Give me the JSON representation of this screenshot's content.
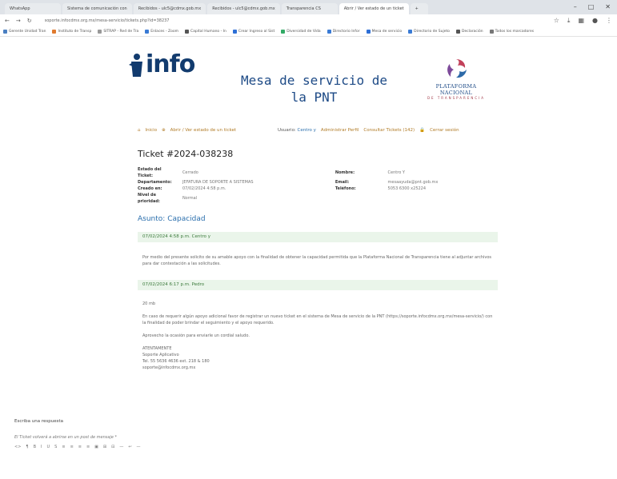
{
  "browser": {
    "tabs": [
      {
        "label": "WhatsApp",
        "active": false
      },
      {
        "label": "Sistema de comunicación con",
        "active": false
      },
      {
        "label": "Recibidos - ulc5@cdmx.gob.mx",
        "active": false
      },
      {
        "label": "Recibidos - ulc5@cdmx.gob.mx",
        "active": false
      },
      {
        "label": "Transparencia CS",
        "active": false
      },
      {
        "label": "Abrir / Ver estado de un ticket",
        "active": true
      }
    ],
    "new_tab": "+",
    "window_controls": [
      "–",
      "□",
      "✕"
    ],
    "url": "soporte.infocdmx.org.mx/mesa-servicio/tickets.php?id=38237",
    "bookmarks": [
      "Gerente Unidad Tran",
      "Instituto de Transp",
      "SITRAP - Red de Tra",
      "Enlaces - Zoom",
      "Capital Humano - In",
      "Crear Ingreso al Sist",
      "Diversidad de Vida",
      "Directorio Infor",
      "Mesa de servicio",
      "Directorio de Sujeto",
      "Declaración",
      "Todos los marcadores"
    ]
  },
  "header": {
    "logo": "info",
    "title": "Mesa de servicio de la PNT",
    "pnt_name": "PLATAFORMA NACIONAL",
    "pnt_sub": "DE TRANSPARENCIA"
  },
  "nav": {
    "inicio": "Inicio",
    "abrir": "Abrir / Ver estado de un ticket",
    "usuario_label": "Usuario:",
    "usuario_name": "Centro y",
    "admin": "Administrar Perfil",
    "consultar": "Consultar Tickets (142)",
    "cerrar": "Cerrar sesión"
  },
  "ticket": {
    "title": "Ticket #2024-038238",
    "fields_left": [
      {
        "key": "Estado del Ticket:",
        "value": "Cerrado"
      },
      {
        "key": "Departamento:",
        "value": "JEFATURA DE SOPORTE A SISTEMAS"
      },
      {
        "key": "Creado en:",
        "value": "07/02/2024 4:58 p.m."
      },
      {
        "key": "Nivel de prioridad:",
        "value": "Normal"
      }
    ],
    "fields_right": [
      {
        "key": "Nombre:",
        "value": "Centro Y"
      },
      {
        "key": "Email:",
        "value": "mesaayuda@pnt.gob.mx"
      },
      {
        "key": "Teléfono:",
        "value": "5053 6300 x25224"
      },
      {
        "key": "",
        "value": ""
      }
    ],
    "asunto_label": "Asunto:",
    "asunto": "Capacidad"
  },
  "messages": [
    {
      "header": "07/02/2024 4:58 p.m.  Centro y",
      "body": [
        "Por medio del presente solicito de su amable apoyo con la finalidad de obtener la capacidad permitida que la Plataforma Nacional de Transparencia tiene al adjuntar archivos para dar contestación a las solicitudes."
      ]
    },
    {
      "header": "07/02/2024 6:17 p.m.  Pedro",
      "body": [
        "20 mb",
        "En caso de requerir algún apoyo adicional favor de registrar un nuevo ticket en el sistema de Mesa de servicio de la PNT (https://soporte.infocdmx.org.mx/mesa-servicio/) con la finalidad de poder brindar el seguimiento y el apoyo requerido.",
        "Aprovecho la ocasión para enviarle un cordial saludo.",
        "ATENTAMENTE",
        "Soporte Aplicativo",
        "Tel. 55 5636 4636 ext. 218 & 180",
        "soporte@infocdmx.org.mx"
      ]
    }
  ],
  "reply": {
    "label": "Escriba una respuesta",
    "reopen_note": "El Ticket volverá a abrirse en un post de mensaje *",
    "toolbar": [
      "<>",
      "¶",
      "B",
      "I",
      "U",
      "S",
      "≡",
      "≡",
      "≡",
      "≡",
      "▣",
      "⊞",
      "⊟",
      "—",
      "↩",
      "—"
    ]
  },
  "colors": {
    "brand": "#123b6e",
    "accent": "#b07a25",
    "link": "#2b6fad",
    "msg_bg": "#eaf5ea"
  }
}
